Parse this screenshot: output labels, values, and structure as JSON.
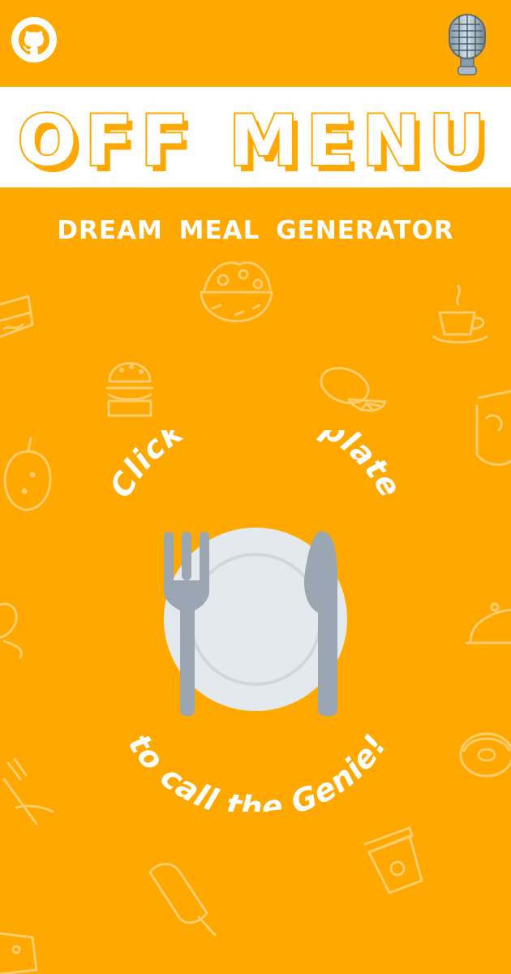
{
  "header": {
    "github_icon": "github-icon",
    "mic_icon": "microphone-icon"
  },
  "title": {
    "text": "OFF MENU"
  },
  "subtitle": {
    "text": "DREAM MEAL GENERATOR"
  },
  "plate": {
    "prompt_top": "Click on the plate",
    "prompt_bottom": "to call the Genie!",
    "icons": [
      "fork-icon",
      "plate-icon",
      "knife-icon"
    ]
  },
  "colors": {
    "background": "#ffa800",
    "title_band": "#ffffff",
    "title_fill": "#ffa800",
    "text": "#ffffff",
    "plate": "#e4e9ee",
    "cutlery": "#9aa7b2"
  }
}
